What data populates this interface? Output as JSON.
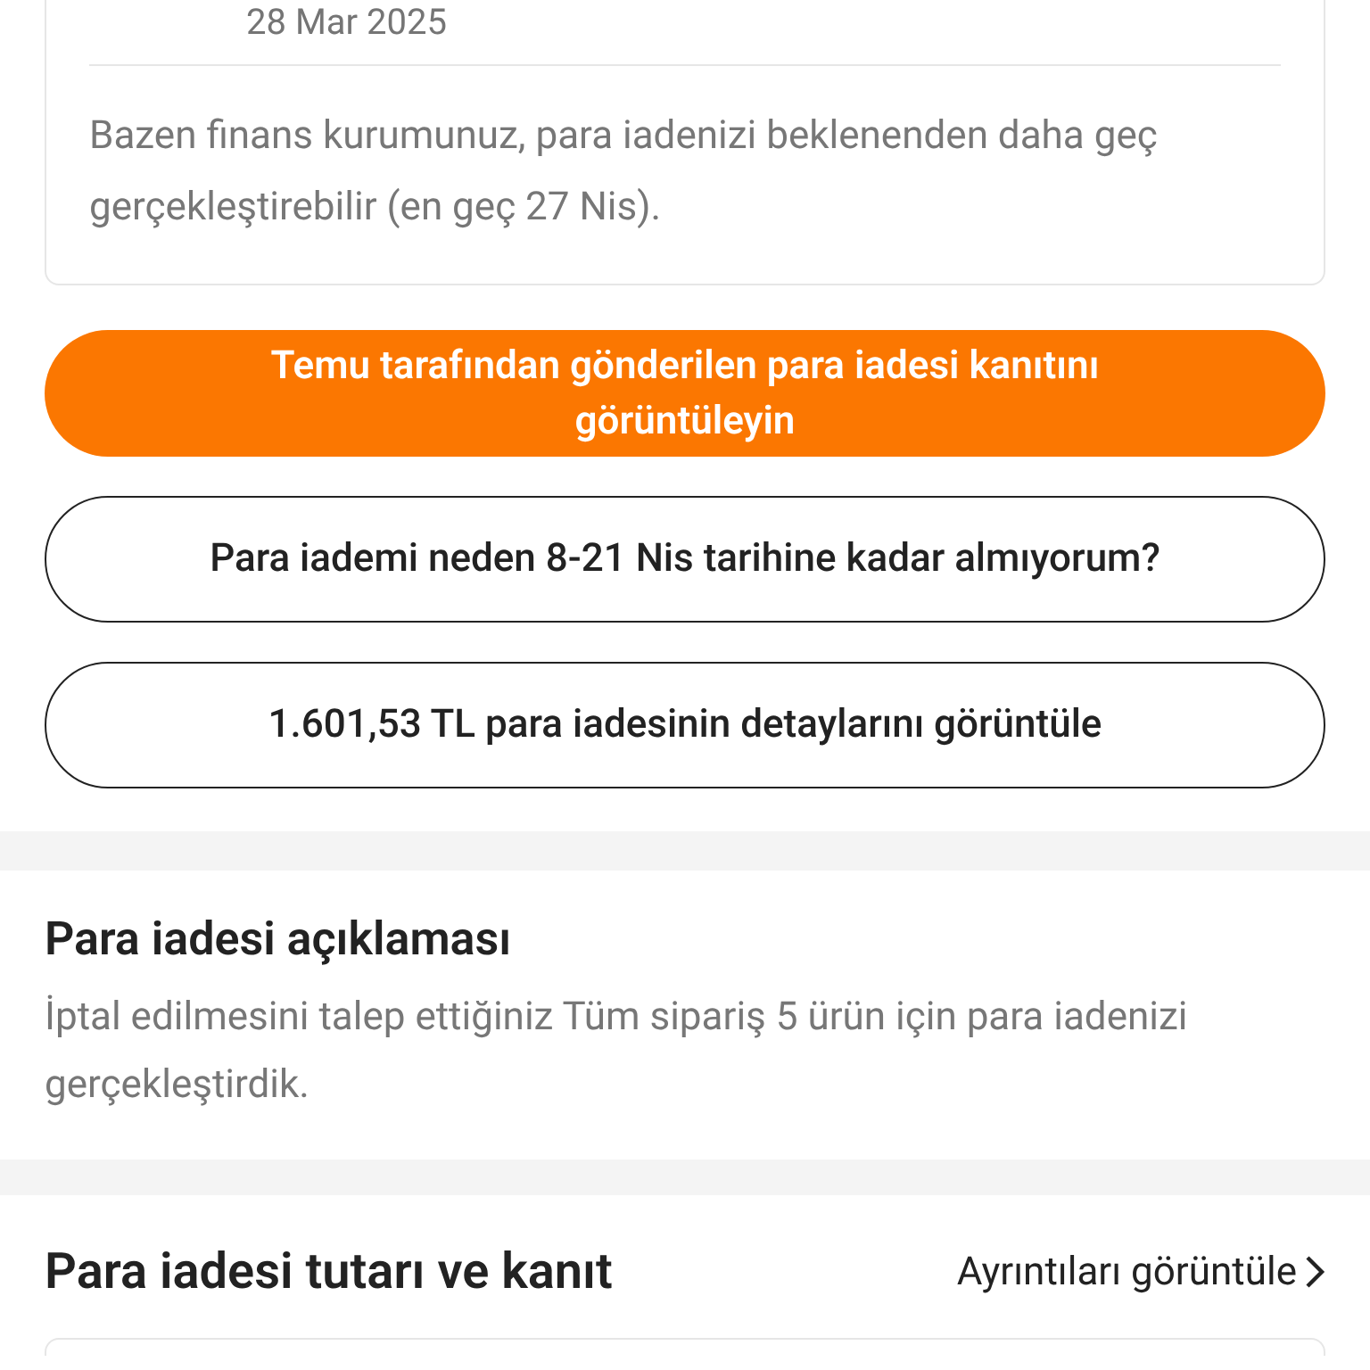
{
  "refund_card": {
    "date": "28 Mar 2025",
    "note": "Bazen finans kurumunuz, para iadenizi beklenenden daha geç gerçekleştirebilir (en geç 27 Nis)."
  },
  "buttons": [
    {
      "kind": "primary",
      "label": "Temu tarafından gönderilen para iadesi kanıtını görüntüleyin"
    },
    {
      "kind": "outline",
      "label": "Para iademi neden 8-21 Nis tarihine kadar almıyorum?"
    },
    {
      "kind": "outline",
      "label": "1.601,53 TL para iadesinin detaylarını görüntüle"
    }
  ],
  "explanation": {
    "title": "Para iadesi açıklaması",
    "text": "İptal edilmesini talep ettiğiniz Tüm sipariş 5 ürün için para iadenizi gerçekleştirdik."
  },
  "amount_section": {
    "title": "Para iadesi tutarı ve kanıt",
    "link": "Ayrıntıları görüntüle"
  }
}
